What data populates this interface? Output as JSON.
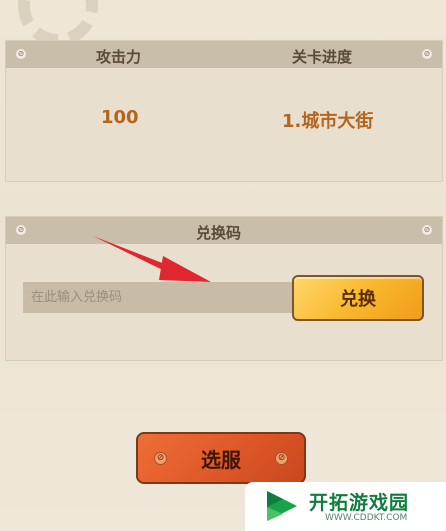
{
  "stats_panel": {
    "attack_label": "攻击力",
    "progress_label": "关卡进度",
    "attack_value": "100",
    "progress_value": "1.城市大街"
  },
  "redeem_panel": {
    "title": "兑换码",
    "input_placeholder": "在此输入兑换码",
    "redeem_button": "兑换"
  },
  "server_button": "选服",
  "watermark": {
    "title": "开拓游戏园",
    "url": "WWW.CDDKT.COM"
  },
  "colors": {
    "panel_header": "#c9bea9",
    "value_orange": "#b4651d",
    "redeem_button": "#f8b52a",
    "server_button": "#de5728",
    "arrow": "#e0262f",
    "watermark_green": "#0f7d3d"
  },
  "icons": [
    "gear-decoration",
    "rivet-icon",
    "red-arrow-icon",
    "watermark-logo-icon"
  ]
}
